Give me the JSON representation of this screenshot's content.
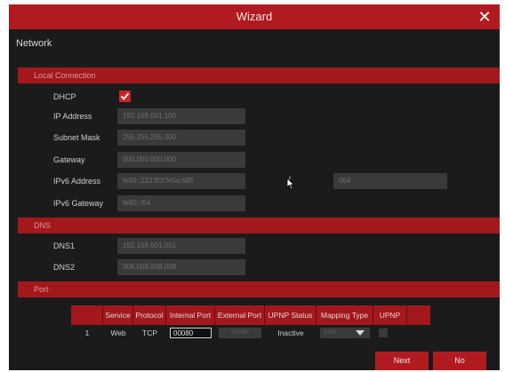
{
  "window": {
    "title": "Wizard"
  },
  "page_heading": "Network",
  "sections": {
    "local": "Local Connection",
    "dns": "DNS",
    "port": "Port"
  },
  "local_connection": {
    "dhcp_label": "DHCP",
    "dhcp_checked": true,
    "ip_label": "IP Address",
    "ip_value": "192.168.001.100",
    "subnet_label": "Subnet Mask",
    "subnet_value": "255.255.255.000",
    "gateway_label": "Gateway",
    "gateway_value": "000.000.000.000",
    "ipv6_label": "IPv6 Address",
    "ipv6_value": "fe80::223:ff0f:fe5a:685",
    "ipv6_separator": "/",
    "ipv6_prefix": "064",
    "ipv6_gateway_label": "IPv6 Gateway",
    "ipv6_gateway_value": "fe80::/64"
  },
  "dns": {
    "dns1_label": "DNS1",
    "dns1_value": "192.168.001.001",
    "dns2_label": "DNS2",
    "dns2_value": "008.008.008.008"
  },
  "port_table": {
    "headers": [
      "",
      "Service",
      "Protocol",
      "Internal Port",
      "External Port",
      "UPNP Status",
      "Mapping Type",
      "UPNP"
    ],
    "row": {
      "index": "1",
      "service": "Web",
      "protocol": "TCP",
      "internal_port": "00080",
      "external_port": "00080",
      "upnp_status": "Inactive",
      "mapping_type": "Auto"
    }
  },
  "buttons": {
    "next": "Next",
    "no": "No"
  },
  "colors": {
    "accent": "#b11b1f",
    "section": "#a3181c",
    "background": "#1b1b1c",
    "field": "#3a3a3c"
  }
}
